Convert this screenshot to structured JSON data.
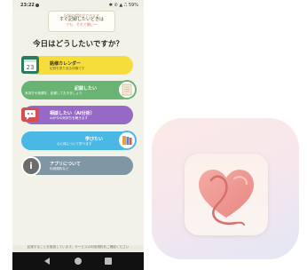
{
  "status": {
    "time": "23:22",
    "indicators": "✱ ✆ ▲ ⎍ 59%"
  },
  "bubble": {
    "line1": "記録や相談ができます",
    "line2": "すぐ記録したいときは",
    "line3": "でも、それで願い〜"
  },
  "title": "今日はどうしたいですか？",
  "menu": {
    "calendar": {
      "label": "銘様カレンダー",
      "desc": "記録を振り返る体験です",
      "icon_text": "23"
    },
    "record": {
      "label": "記録したい",
      "desc": "気持ちや体調を、記録しておきましょう"
    },
    "consult": {
      "label": "相談したい（AI分析）",
      "desc": "AIが今の気持ちを聴きます"
    },
    "learn": {
      "label": "学びたい",
      "desc": "心と体について学べます"
    },
    "about": {
      "label": "アプリについて",
      "desc": "利用規約など",
      "icon_text": "i"
    }
  },
  "footer": "記録することを推奨しています。サービスの利用規約をご確認ください",
  "colors": {
    "calendar": "#f7dd3a",
    "record": "#69b472",
    "consult": "#9669c6",
    "learn": "#49b8e4",
    "about": "#7f96a4"
  },
  "icons": {
    "calendar": "calendar-icon",
    "record": "notepad-icon",
    "consult": "chat-icon",
    "learn": "book-icon",
    "about": "info-icon",
    "app": "heart-logo-icon"
  }
}
